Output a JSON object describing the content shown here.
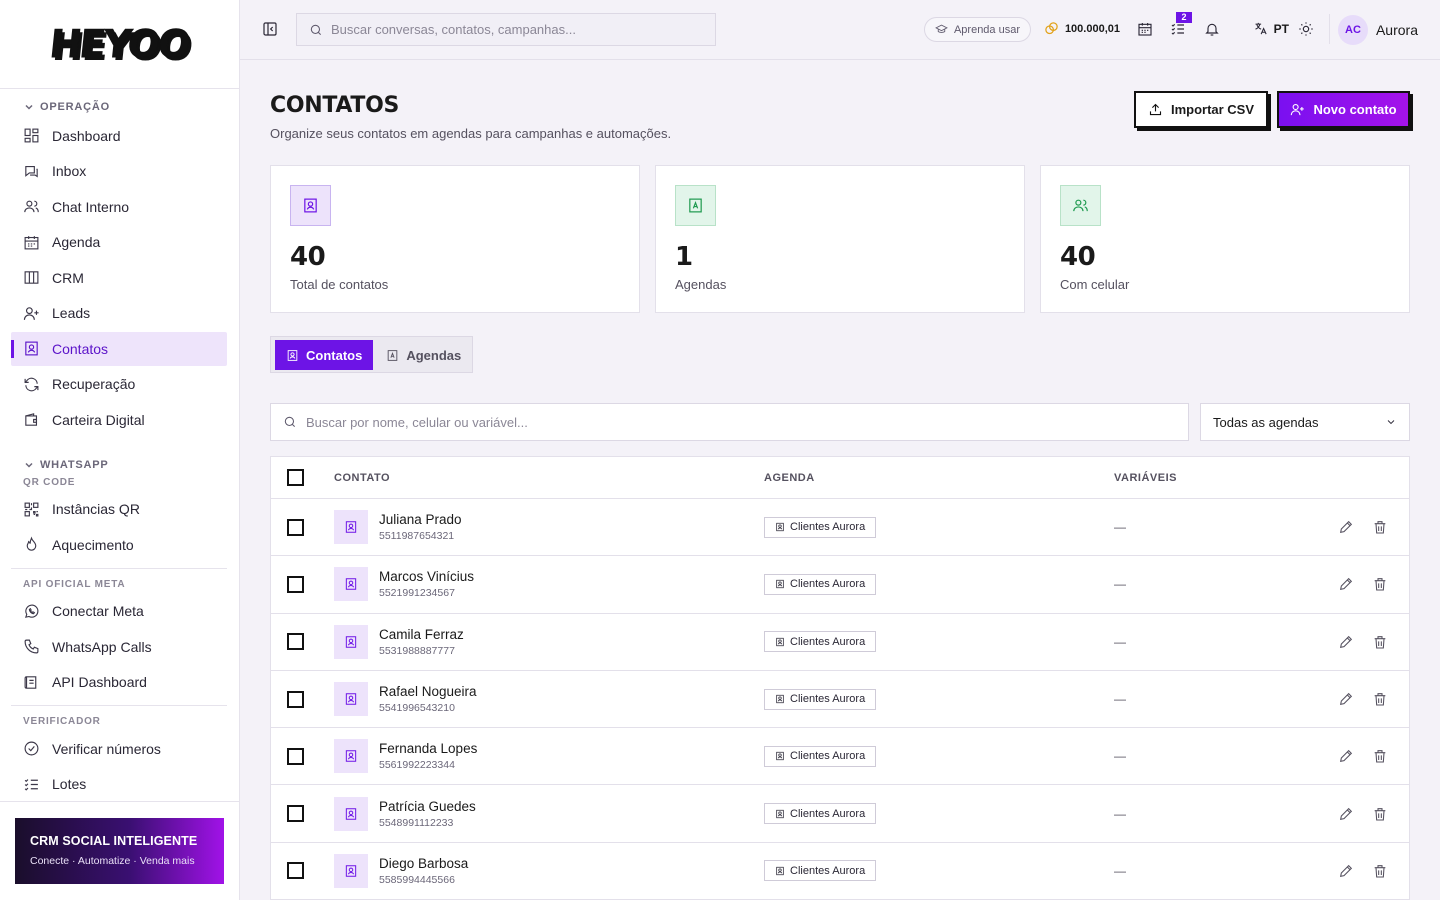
{
  "brand": {
    "logo_text": "HEYOO"
  },
  "sidebar": {
    "sections": [
      {
        "title": "OPERAÇÃO"
      },
      {
        "title": "WHATSAPP",
        "subtitle": "QR CODE"
      },
      {
        "title": "API OFICIAL META"
      },
      {
        "title": "VERIFICADOR"
      }
    ],
    "items": [
      {
        "label": "Dashboard",
        "icon": "dashboard-icon"
      },
      {
        "label": "Inbox",
        "icon": "inbox-icon"
      },
      {
        "label": "Chat Interno",
        "icon": "users-icon"
      },
      {
        "label": "Agenda",
        "icon": "calendar-icon"
      },
      {
        "label": "CRM",
        "icon": "columns-icon"
      },
      {
        "label": "Leads",
        "icon": "user-plus-icon"
      },
      {
        "label": "Contatos",
        "icon": "contact-book-icon",
        "active": true
      },
      {
        "label": "Recuperação",
        "icon": "refresh-icon"
      },
      {
        "label": "Carteira Digital",
        "icon": "wallet-icon"
      },
      {
        "label": "Instâncias QR",
        "icon": "qr-code-icon"
      },
      {
        "label": "Aquecimento",
        "icon": "flame-icon"
      },
      {
        "label": "Conectar Meta",
        "icon": "whatsapp-icon"
      },
      {
        "label": "WhatsApp Calls",
        "icon": "phone-icon"
      },
      {
        "label": "API Dashboard",
        "icon": "api-book-icon"
      },
      {
        "label": "Verificar números",
        "icon": "check-circle-icon"
      },
      {
        "label": "Lotes",
        "icon": "list-check-icon"
      }
    ],
    "promo": {
      "title": "CRM SOCIAL INTELIGENTE",
      "subtitle": "Conecte · Automatize · Venda mais"
    }
  },
  "topbar": {
    "search_placeholder": "Buscar conversas, contatos, campanhas...",
    "learn_label": "Aprenda usar",
    "credits": "100.000,01",
    "tasks_badge": "2",
    "language": "PT",
    "user_initials": "AC",
    "user_name": "Aurora"
  },
  "page": {
    "title": "CONTATOS",
    "subtitle": "Organize seus contatos em agendas para campanhas e automações.",
    "import_label": "Importar CSV",
    "new_label": "Novo contato"
  },
  "stats": [
    {
      "value": "40",
      "label": "Total de contatos",
      "color": "#6d14e6"
    },
    {
      "value": "1",
      "label": "Agendas",
      "color": "#1e9a4f"
    },
    {
      "value": "40",
      "label": "Com celular",
      "color": "#1e9a4f"
    }
  ],
  "tabs": [
    {
      "label": "Contatos",
      "active": true
    },
    {
      "label": "Agendas",
      "active": false
    }
  ],
  "filters": {
    "search_placeholder": "Buscar por nome, celular ou variável...",
    "agenda_select": "Todas as agendas"
  },
  "table": {
    "headers": {
      "contact": "CONTATO",
      "agenda": "AGENDA",
      "vars": "VARIÁVEIS"
    },
    "rows": [
      {
        "name": "Juliana Prado",
        "phone": "5511987654321",
        "agenda": "Clientes Aurora",
        "vars": "—"
      },
      {
        "name": "Marcos Vinícius",
        "phone": "5521991234567",
        "agenda": "Clientes Aurora",
        "vars": "—"
      },
      {
        "name": "Camila Ferraz",
        "phone": "5531988887777",
        "agenda": "Clientes Aurora",
        "vars": "—"
      },
      {
        "name": "Rafael Nogueira",
        "phone": "5541996543210",
        "agenda": "Clientes Aurora",
        "vars": "—"
      },
      {
        "name": "Fernanda Lopes",
        "phone": "5561992223344",
        "agenda": "Clientes Aurora",
        "vars": "—"
      },
      {
        "name": "Patrícia Guedes",
        "phone": "5548991112233",
        "agenda": "Clientes Aurora",
        "vars": "—"
      },
      {
        "name": "Diego Barbosa",
        "phone": "5585994445566",
        "agenda": "Clientes Aurora",
        "vars": "—"
      }
    ]
  },
  "colors": {
    "accent": "#6d14e6",
    "active_bg": "#eee4fb",
    "success": "#1e9a4f"
  }
}
